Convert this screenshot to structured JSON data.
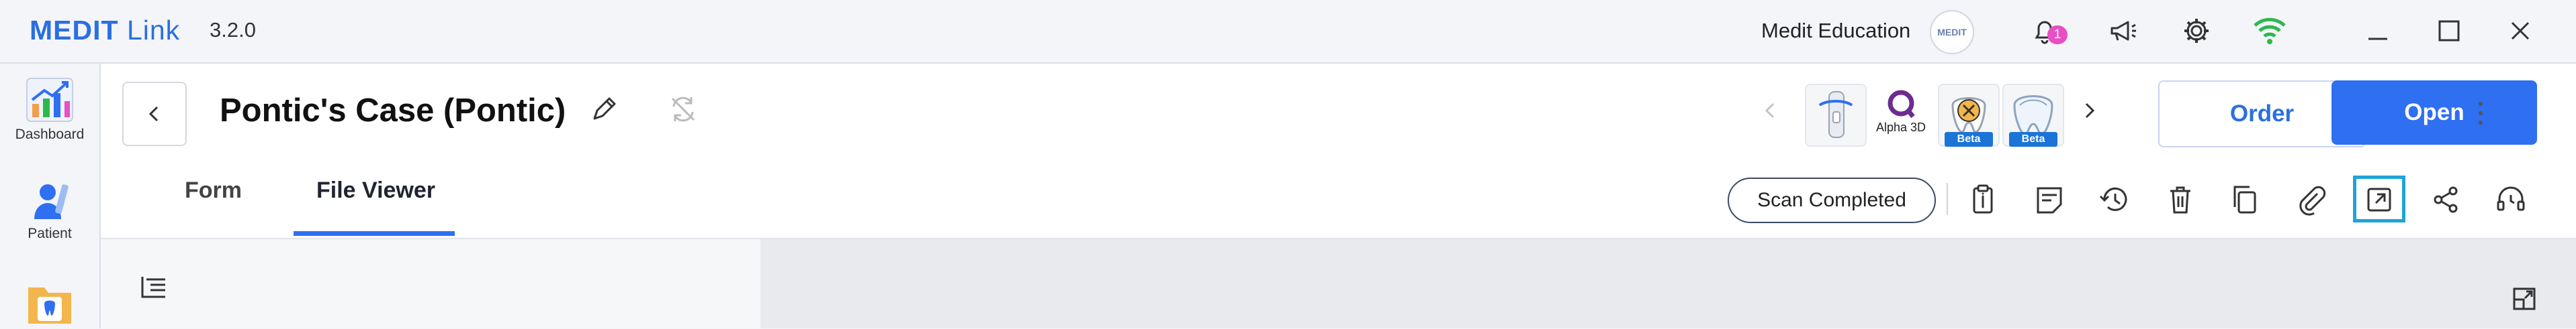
{
  "app": {
    "name_bold": "MEDIT",
    "name_light": " Link",
    "version": "3.2.0"
  },
  "titlebar": {
    "org_name": "Medit Education",
    "org_badge": "MEDIT",
    "notification_count": "1"
  },
  "sidebar": {
    "items": [
      {
        "label": "Dashboard",
        "icon": "dashboard-chart-icon"
      },
      {
        "label": "Patient",
        "icon": "patient-icon"
      },
      {
        "label": "",
        "icon": "case-folder-icon"
      }
    ]
  },
  "case": {
    "title": "Pontic's Case (Pontic)"
  },
  "actions": {
    "order_label": "Order",
    "open_label": "Open"
  },
  "apps": {
    "alpha_label": "Alpha 3D",
    "beta_label": "Beta"
  },
  "tabs": [
    {
      "label": "Form",
      "active": false
    },
    {
      "label": "File Viewer",
      "active": true
    }
  ],
  "status": {
    "scan": "Scan Completed"
  },
  "colors": {
    "accent": "#2f6ff1",
    "highlight": "#1fa4d8",
    "wifi": "#2db84d",
    "badge": "#e84fc4"
  }
}
